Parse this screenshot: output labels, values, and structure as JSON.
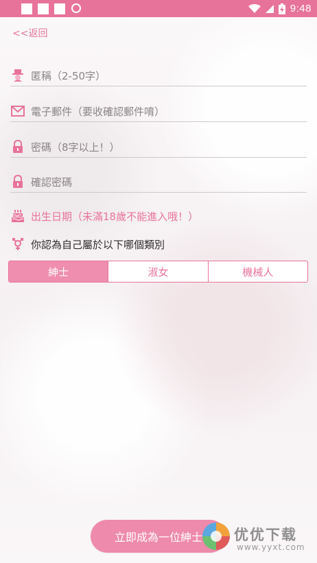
{
  "status_bar": {
    "time": "9:48",
    "color": "#e8739a"
  },
  "nav": {
    "back_label": "<<返回"
  },
  "form": {
    "nickname_placeholder": "匿稱（2-50字）",
    "email_placeholder": "電子郵件（要收確認郵件唷）",
    "password_placeholder": "密碼（8字以上！）",
    "confirm_password_placeholder": "確認密碼",
    "birthday_label": "出生日期（未滿18歲不能進入哦！）",
    "gender_question": "你認為自己屬於以下哪個類別",
    "gender_options": [
      "紳士",
      "淑女",
      "機械人"
    ],
    "gender_selected": "紳士"
  },
  "submit": {
    "label": "立即成為一位紳士"
  },
  "watermark": {
    "title": "优优下载",
    "url": "www.yyxt.com"
  },
  "colors": {
    "accent": "#e8739a",
    "accent_light": "#ef8eae"
  }
}
